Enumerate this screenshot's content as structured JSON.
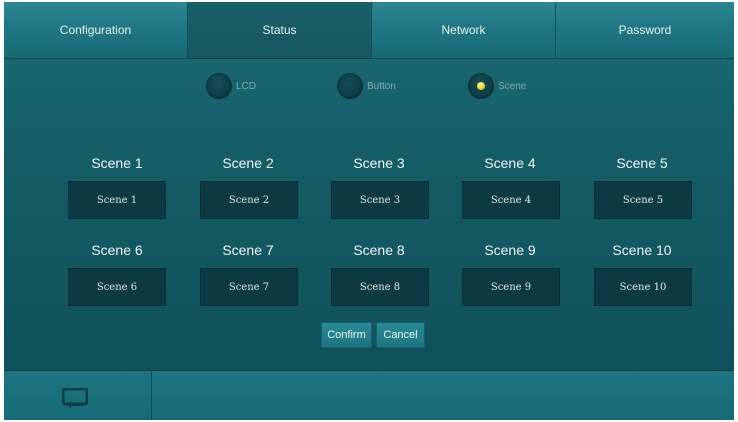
{
  "tabs": [
    {
      "label": "Configuration"
    },
    {
      "label": "Status"
    },
    {
      "label": "Network"
    },
    {
      "label": "Password"
    }
  ],
  "active_tab": "Status",
  "mode": {
    "options": [
      {
        "label": "LCD",
        "selected": false
      },
      {
        "label": "Button",
        "selected": false
      },
      {
        "label": "Scene",
        "selected": true
      }
    ]
  },
  "scenes": [
    {
      "label": "Scene 1",
      "value": "Scene 1"
    },
    {
      "label": "Scene 2",
      "value": "Scene 2"
    },
    {
      "label": "Scene 3",
      "value": "Scene 3"
    },
    {
      "label": "Scene 4",
      "value": "Scene 4"
    },
    {
      "label": "Scene 5",
      "value": "Scene 5"
    },
    {
      "label": "Scene 6",
      "value": "Scene 6"
    },
    {
      "label": "Scene 7",
      "value": "Scene 7"
    },
    {
      "label": "Scene 8",
      "value": "Scene 8"
    },
    {
      "label": "Scene 9",
      "value": "Scene 9"
    },
    {
      "label": "Scene 10",
      "value": "Scene 10"
    }
  ],
  "actions": {
    "confirm_label": "Confirm",
    "cancel_label": "Cancel"
  },
  "footer": {
    "back_icon": "back-return-icon"
  },
  "colors": {
    "background": "#135a64",
    "tab_bar": "#1f7581",
    "active_tab": "#155661",
    "field": "#0d3942",
    "selected_radio": "#e7d63c"
  }
}
